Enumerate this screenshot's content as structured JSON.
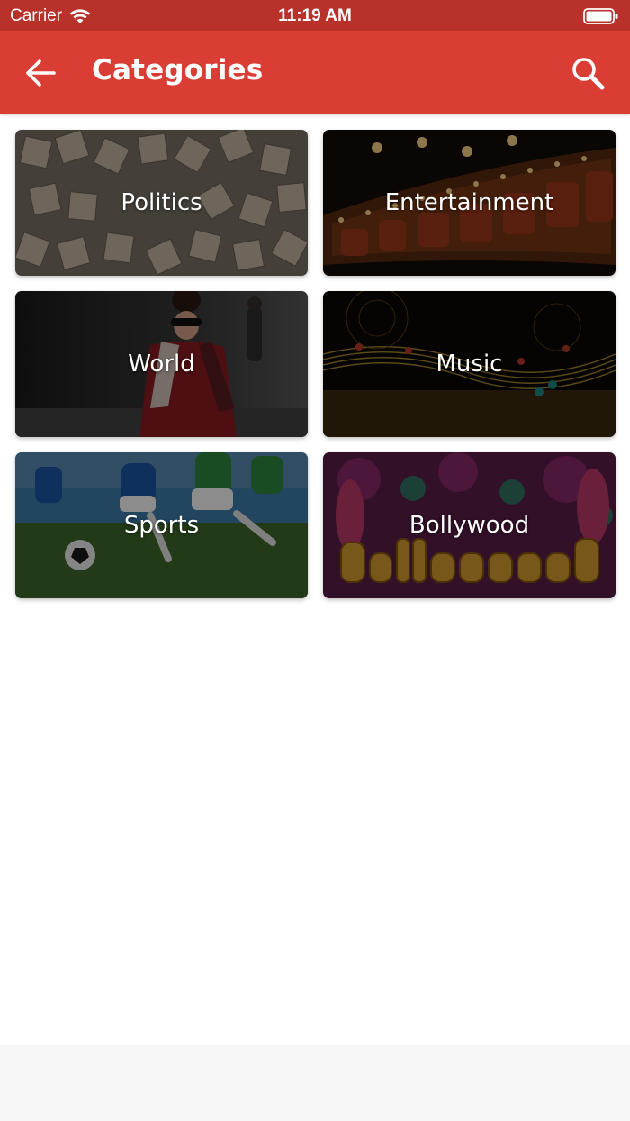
{
  "status_bar": {
    "carrier": "Carrier",
    "time": "11:19 AM"
  },
  "header": {
    "title": "Categories",
    "back_icon": "arrow-left-icon",
    "search_icon": "search-icon",
    "background": "#d93d33"
  },
  "categories": [
    {
      "label": "Politics"
    },
    {
      "label": "Entertainment"
    },
    {
      "label": "World"
    },
    {
      "label": "Music"
    },
    {
      "label": "Sports"
    },
    {
      "label": "Bollywood"
    }
  ]
}
